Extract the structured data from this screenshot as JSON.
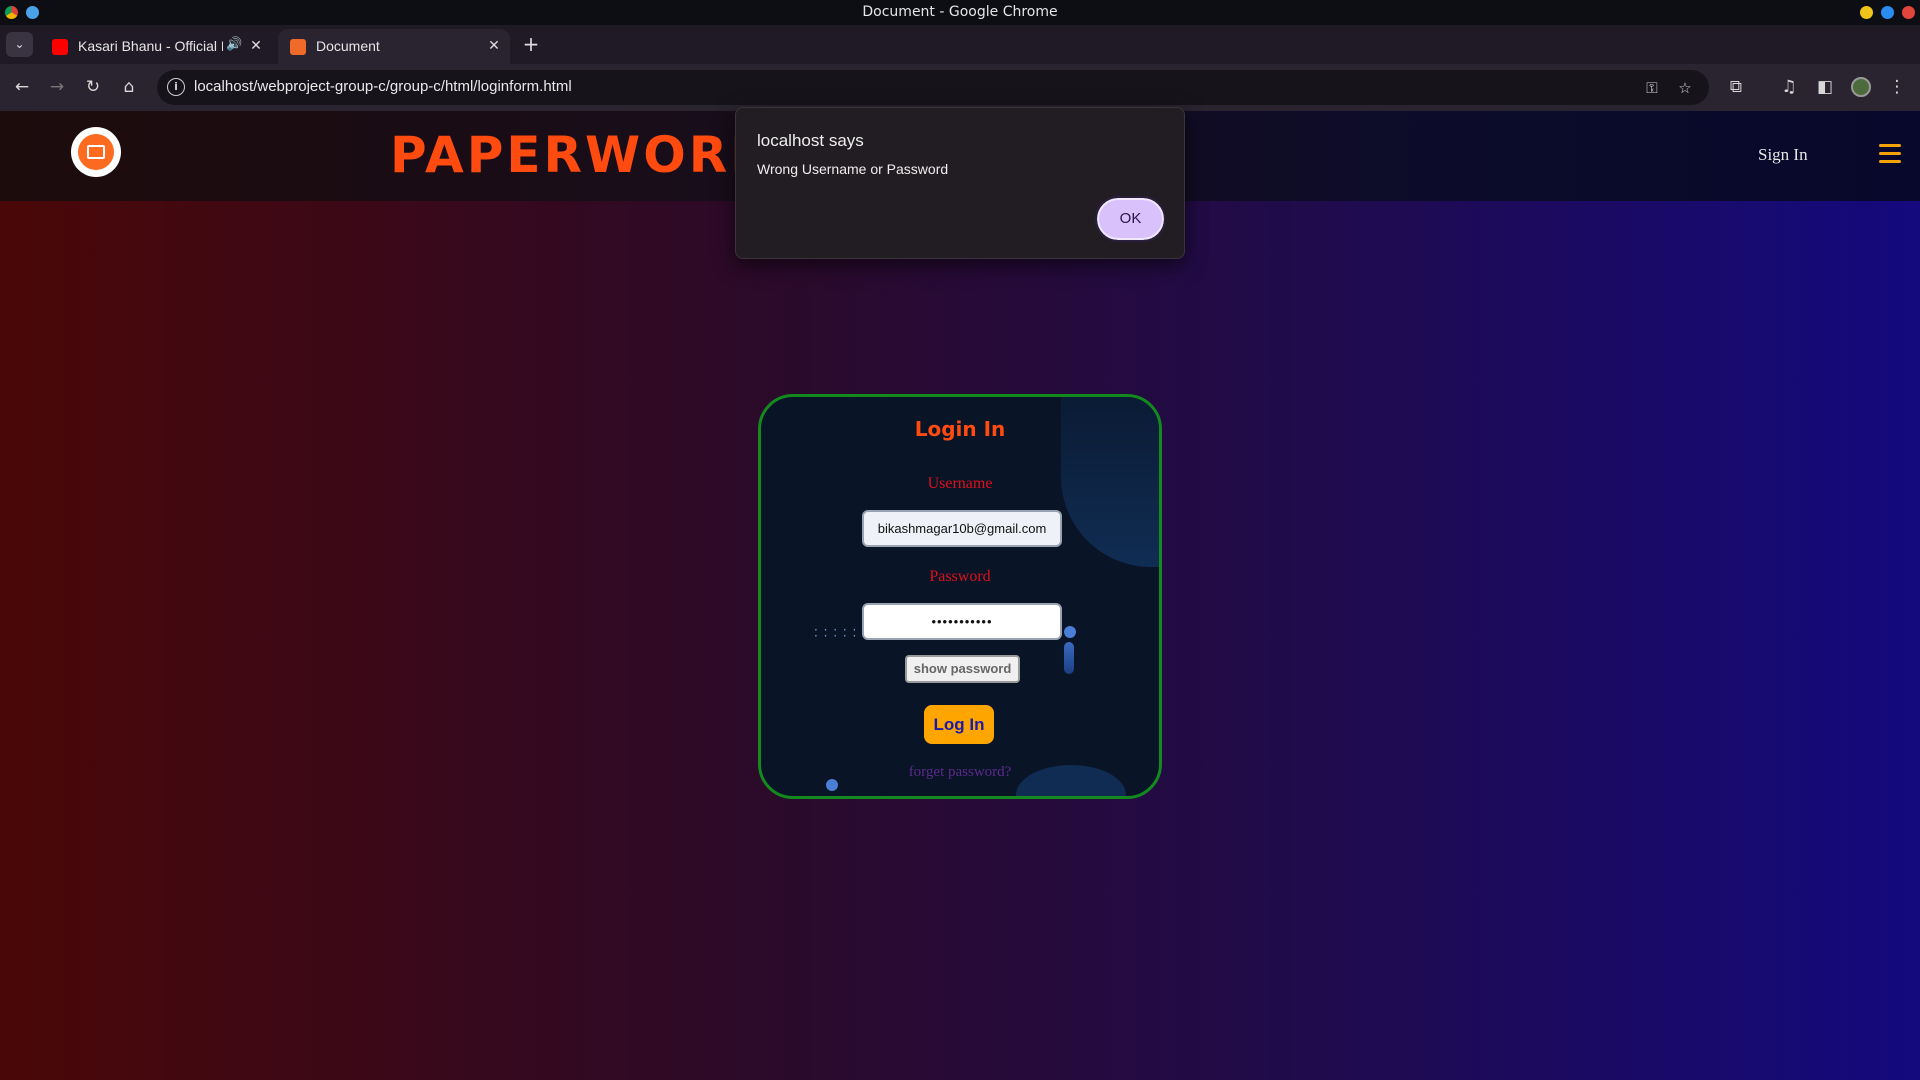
{
  "window": {
    "title": "Document - Google Chrome"
  },
  "tabs": [
    {
      "label": "Kasari Bhanu - Official L",
      "active": false,
      "favicon": "youtube-icon",
      "audio": true
    },
    {
      "label": "Document",
      "active": true,
      "favicon": "html-icon",
      "audio": false
    }
  ],
  "toolbar": {
    "url": "localhost/webproject-group-c/group-c/html/loginform.html"
  },
  "site": {
    "name": "PAPERWORI",
    "sign_in": "Sign In",
    "brand_color": "#ff4a10",
    "menu_color": "#f5a300"
  },
  "login": {
    "title": "Login In",
    "username_label": "Username",
    "username_value": "bikashmagar10b@gmail.com",
    "password_label": "Password",
    "password_value": "•••••••••••",
    "show_password": "show password",
    "submit": "Log In",
    "forget": "forget password?",
    "border_color": "#138a1e",
    "button_color": "#ffa500"
  },
  "dialog": {
    "title": "localhost says",
    "message": "Wrong Username or Password",
    "ok": "OK"
  }
}
